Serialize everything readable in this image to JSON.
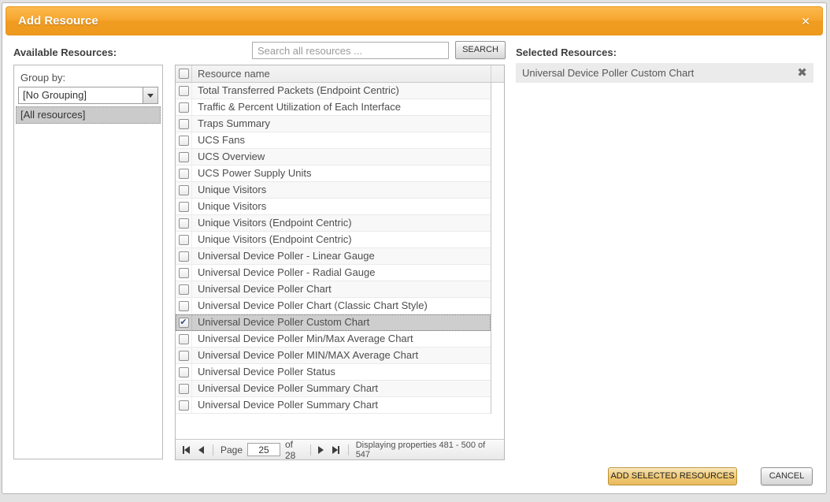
{
  "dialog": {
    "title": "Add Resource"
  },
  "icons": {
    "close": "✕",
    "remove": "✖",
    "check": "✔"
  },
  "available": {
    "label": "Available Resources:",
    "group_by_label": "Group by:",
    "group_by_value": "[No Grouping]",
    "group_items": [
      "[All resources]"
    ]
  },
  "search": {
    "placeholder": "Search all resources ...",
    "button_label": "SEARCH"
  },
  "table": {
    "header": "Resource name",
    "rows": [
      {
        "label": "Total Transferred Packets (Endpoint Centric)",
        "checked": false,
        "selected": false
      },
      {
        "label": "Traffic & Percent Utilization of Each Interface",
        "checked": false,
        "selected": false
      },
      {
        "label": "Traps Summary",
        "checked": false,
        "selected": false
      },
      {
        "label": "UCS Fans",
        "checked": false,
        "selected": false
      },
      {
        "label": "UCS Overview",
        "checked": false,
        "selected": false
      },
      {
        "label": "UCS Power Supply Units",
        "checked": false,
        "selected": false
      },
      {
        "label": "Unique Visitors",
        "checked": false,
        "selected": false
      },
      {
        "label": "Unique Visitors",
        "checked": false,
        "selected": false
      },
      {
        "label": "Unique Visitors (Endpoint Centric)",
        "checked": false,
        "selected": false
      },
      {
        "label": "Unique Visitors (Endpoint Centric)",
        "checked": false,
        "selected": false
      },
      {
        "label": "Universal Device Poller - Linear Gauge",
        "checked": false,
        "selected": false
      },
      {
        "label": "Universal Device Poller - Radial Gauge",
        "checked": false,
        "selected": false
      },
      {
        "label": "Universal Device Poller Chart",
        "checked": false,
        "selected": false
      },
      {
        "label": "Universal Device Poller Chart (Classic Chart Style)",
        "checked": false,
        "selected": false
      },
      {
        "label": "Universal Device Poller Custom Chart",
        "checked": true,
        "selected": true
      },
      {
        "label": "Universal Device Poller Min/Max Average Chart",
        "checked": false,
        "selected": false
      },
      {
        "label": "Universal Device Poller MIN/MAX Average Chart",
        "checked": false,
        "selected": false
      },
      {
        "label": "Universal Device Poller Status",
        "checked": false,
        "selected": false
      },
      {
        "label": "Universal Device Poller Summary Chart",
        "checked": false,
        "selected": false
      },
      {
        "label": "Universal Device Poller Summary Chart",
        "checked": false,
        "selected": false
      }
    ]
  },
  "pagination": {
    "page_label": "Page",
    "page_value": "25",
    "of_label": "of 28",
    "status": "Displaying properties 481 - 500 of 547"
  },
  "selected_panel": {
    "label": "Selected Resources:",
    "items": [
      "Universal Device Poller Custom Chart"
    ]
  },
  "footer": {
    "add_label": "ADD SELECTED RESOURCES",
    "cancel_label": "CANCEL"
  },
  "colors": {
    "header_orange": "#F09C21",
    "header_border": "#E9941A",
    "add_button": "#EFC874",
    "selected_row": "#CECECE",
    "selected_item_bg": "#EBEBEB"
  }
}
